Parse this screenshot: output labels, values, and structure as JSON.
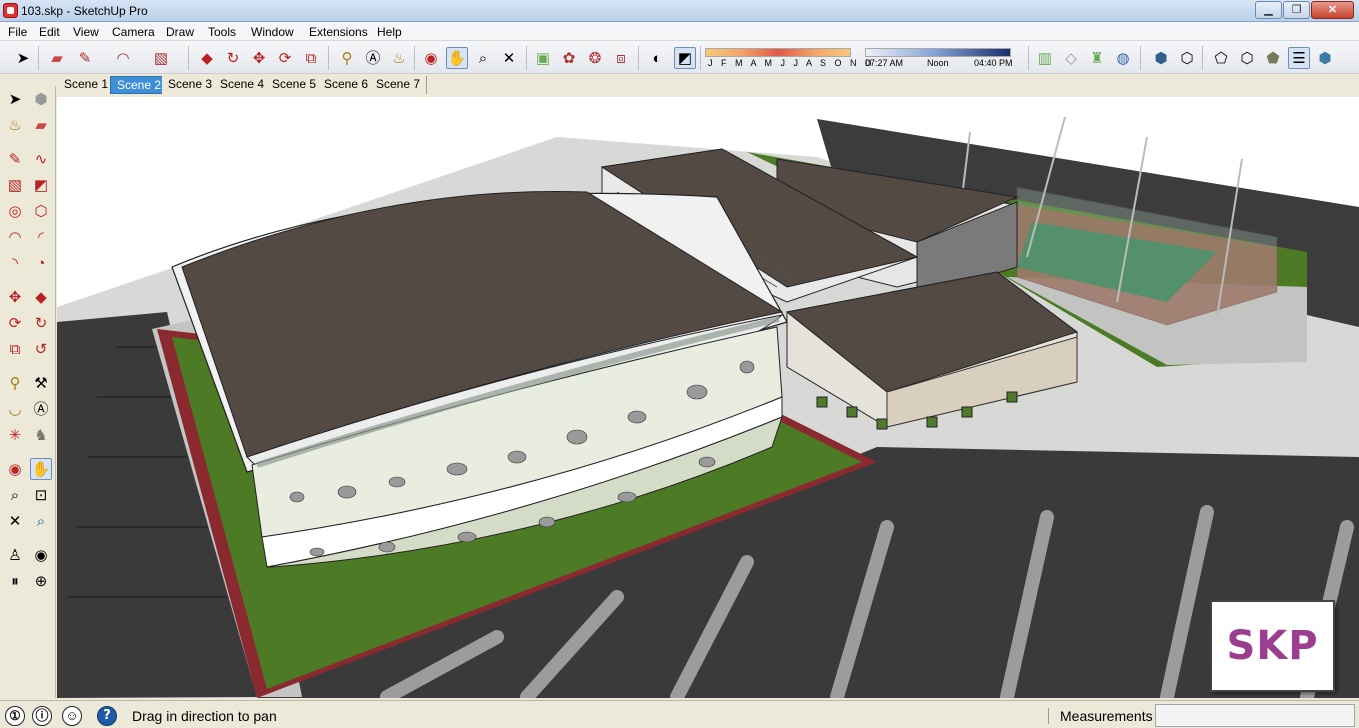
{
  "window": {
    "title": "103.skp - SketchUp Pro",
    "minimize_label": "▁",
    "maximize_label": "❐",
    "close_label": "✕"
  },
  "menu": [
    "File",
    "Edit",
    "View",
    "Camera",
    "Draw",
    "Tools",
    "Window",
    "Extensions",
    "Help"
  ],
  "shadows": {
    "months": "J F M A M J J A S O N D",
    "time_start": "07:27 AM",
    "time_mid": "Noon",
    "time_end": "04:40 PM"
  },
  "scenes": [
    "Scene 1",
    "Scene 2",
    "Scene 3",
    "Scene 4",
    "Scene 5",
    "Scene 6",
    "Scene 7"
  ],
  "active_scene": "Scene 2",
  "viewport": {
    "watermark": "SKP"
  },
  "status": {
    "message": "Drag in direction to pan",
    "measurements_label": "Measurements",
    "measurements_value": ""
  },
  "colors": {
    "accent": "#3E8FD6",
    "grass": "#4D7A24",
    "asphalt": "#3A3A3A",
    "roof": "#5B524C",
    "badge_text": "#9B3E8F"
  }
}
